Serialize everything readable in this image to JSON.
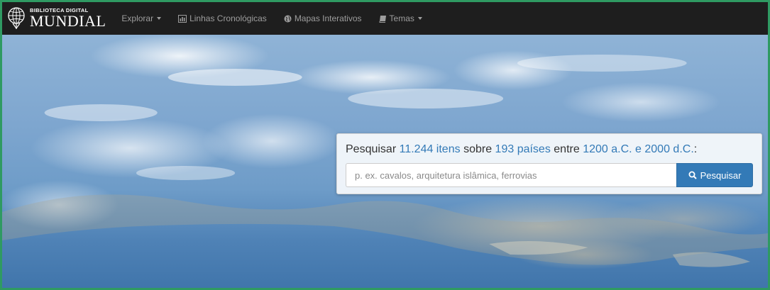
{
  "brand": {
    "line1": "BIBLIOTECA DIGITAL",
    "line2": "MUNDIAL",
    "icon": "globe-icon"
  },
  "nav": {
    "explore": {
      "label": "Explorar",
      "icon": "caret-down-icon"
    },
    "timelines": {
      "label": "Linhas Cronológicas",
      "icon": "bar-chart-icon"
    },
    "maps": {
      "label": "Mapas Interativos",
      "icon": "globe-small-icon"
    },
    "topics": {
      "label": "Temas",
      "icon": "book-icon"
    }
  },
  "search": {
    "prefix": "Pesquisar",
    "items": "11.244 itens",
    "about": "sobre",
    "countries": "193 países",
    "between": "entre",
    "range": "1200 a.C. e 2000 d.C.",
    "suffix": ":",
    "placeholder": "p. ex. cavalos, arquitetura islâmica, ferrovias",
    "button_label": "Pesquisar",
    "button_icon": "search-icon"
  },
  "colors": {
    "navbar": "#1e1e1e",
    "link_blue": "#337ab7",
    "frame_green": "#2f9a62"
  }
}
